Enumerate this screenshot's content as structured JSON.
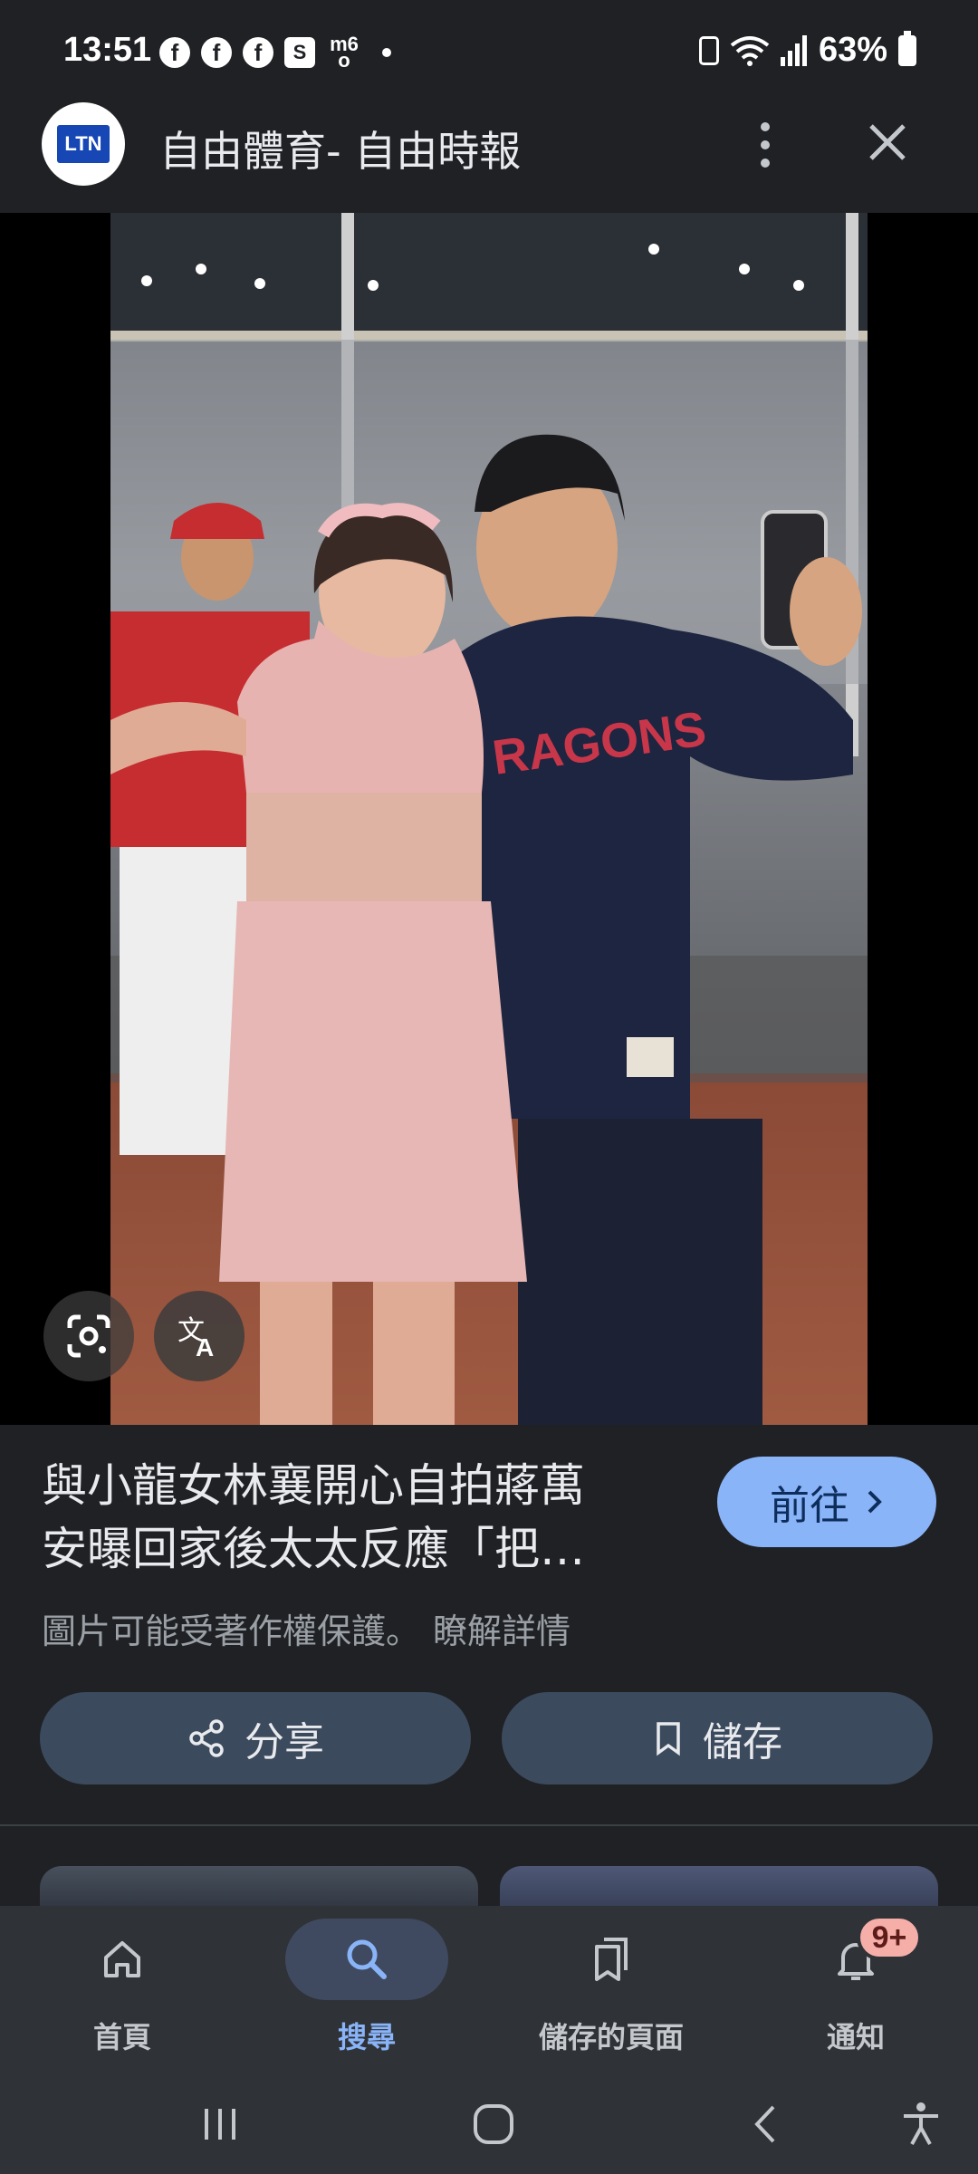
{
  "status_bar": {
    "time": "13:51",
    "notification_icons": [
      "facebook-icon",
      "facebook-icon",
      "facebook-icon",
      "shopping-icon",
      "mo-icon"
    ],
    "battery": "63%"
  },
  "header": {
    "logo_text": "LTN",
    "title": "自由體育- 自由時報"
  },
  "image": {
    "jersey_text": "RAGONS"
  },
  "result": {
    "title": "與小龍女林襄開心自拍蔣萬安曝回家後太太反應「把…",
    "title_line1": "與小龍女林襄開心自拍蔣萬",
    "title_line2": "安曝回家後太太反應「把…",
    "visit_label": "前往",
    "copyright": "圖片可能受著作權保護。",
    "learn_more": "瞭解詳情",
    "share_label": "分享",
    "save_label": "儲存"
  },
  "bottom_nav": {
    "items": [
      {
        "label": "首頁",
        "icon": "home-icon"
      },
      {
        "label": "搜尋",
        "icon": "search-icon",
        "active": true
      },
      {
        "label": "儲存的頁面",
        "icon": "saved-pages-icon"
      },
      {
        "label": "通知",
        "icon": "bell-icon"
      }
    ],
    "badge": "9+"
  },
  "colors": {
    "background": "#1f2124",
    "accent": "#8ab4f8",
    "button_bg": "#3c4a5e",
    "nav_bg": "#2f3237"
  }
}
